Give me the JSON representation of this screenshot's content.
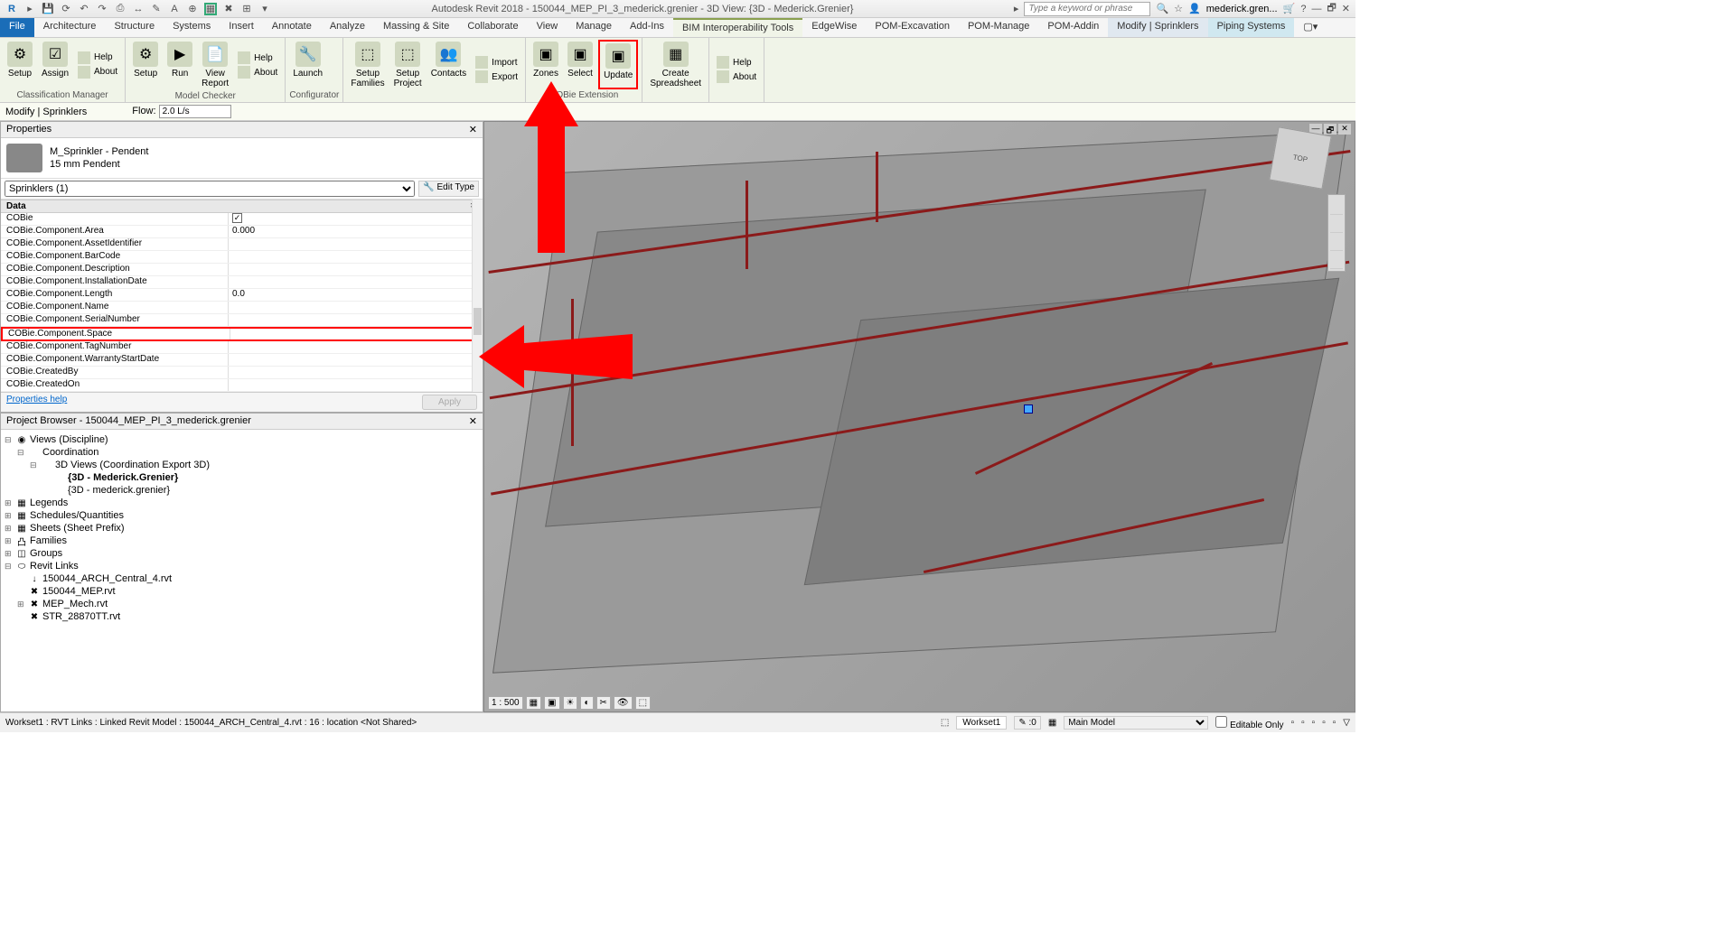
{
  "titlebar": {
    "app": "Autodesk Revit 2018",
    "doc": "150044_MEP_PI_3_mederick.grenier - 3D View: {3D - Mederick.Grenier}",
    "search_placeholder": "Type a keyword or phrase",
    "user": "mederick.gren..."
  },
  "tabs": {
    "file": "File",
    "list": [
      "Architecture",
      "Structure",
      "Systems",
      "Insert",
      "Annotate",
      "Analyze",
      "Massing & Site",
      "Collaborate",
      "View",
      "Manage",
      "Add-Ins",
      "BIM Interoperability Tools",
      "EdgeWise",
      "POM-Excavation",
      "POM-Manage",
      "POM-Addin"
    ],
    "context": [
      "Modify | Sprinklers",
      "Piping Systems"
    ],
    "active": "BIM Interoperability Tools"
  },
  "ribbon": {
    "groups": [
      {
        "label": "Classification Manager",
        "buttons": [
          {
            "l": "Setup"
          },
          {
            "l": "Assign"
          }
        ],
        "small": [
          {
            "l": "Help"
          },
          {
            "l": "About"
          }
        ]
      },
      {
        "label": "Model Checker",
        "buttons": [
          {
            "l": "Setup"
          },
          {
            "l": "Run"
          },
          {
            "l": "View\nReport"
          }
        ],
        "small": [
          {
            "l": "Help"
          },
          {
            "l": "About"
          }
        ]
      },
      {
        "label": "Configurator",
        "buttons": [
          {
            "l": "Launch"
          }
        ]
      },
      {
        "label": "",
        "buttons": [
          {
            "l": "Setup\nFamilies"
          },
          {
            "l": "Setup\nProject"
          },
          {
            "l": "Contacts"
          }
        ],
        "small": [
          {
            "l": "Import"
          },
          {
            "l": "Export"
          }
        ]
      },
      {
        "label": "COBie Extension",
        "buttons": [
          {
            "l": "Zones"
          },
          {
            "l": "Select"
          },
          {
            "l": "Update",
            "hl": true
          }
        ]
      },
      {
        "label": "",
        "buttons": [
          {
            "l": "Create\nSpreadsheet"
          }
        ]
      },
      {
        "label": "",
        "small": [
          {
            "l": "Help"
          },
          {
            "l": "About"
          }
        ]
      }
    ]
  },
  "modifybar": {
    "label": "Modify | Sprinklers",
    "flow_label": "Flow:",
    "flow_value": "2.0 L/s"
  },
  "props": {
    "title": "Properties",
    "type_name": "M_Sprinkler - Pendent",
    "type_size": "15 mm Pendent",
    "selector": "Sprinklers (1)",
    "edit_type": "Edit Type",
    "section": "Data",
    "rows": [
      {
        "n": "COBie",
        "v": "",
        "check": true
      },
      {
        "n": "COBie.Component.Area",
        "v": "0.000"
      },
      {
        "n": "COBie.Component.AssetIdentifier",
        "v": ""
      },
      {
        "n": "COBie.Component.BarCode",
        "v": ""
      },
      {
        "n": "COBie.Component.Description",
        "v": ""
      },
      {
        "n": "COBie.Component.InstallationDate",
        "v": ""
      },
      {
        "n": "COBie.Component.Length",
        "v": "0.0"
      },
      {
        "n": "COBie.Component.Name",
        "v": ""
      },
      {
        "n": "COBie.Component.SerialNumber",
        "v": ""
      },
      {
        "n": "COBie.Component.Space",
        "v": "",
        "hl": true
      },
      {
        "n": "COBie.Component.TagNumber",
        "v": ""
      },
      {
        "n": "COBie.Component.WarrantyStartDate",
        "v": ""
      },
      {
        "n": "COBie.CreatedBy",
        "v": ""
      },
      {
        "n": "COBie.CreatedOn",
        "v": ""
      }
    ],
    "help": "Properties help",
    "apply": "Apply"
  },
  "browser": {
    "title": "Project Browser - 150044_MEP_PI_3_mederick.grenier",
    "nodes": [
      {
        "txt": "Views (Discipline)",
        "ind": 0,
        "exp": "⊟",
        "icon": "◉"
      },
      {
        "txt": "Coordination",
        "ind": 1,
        "exp": "⊟"
      },
      {
        "txt": "3D Views (Coordination Export 3D)",
        "ind": 2,
        "exp": "⊟"
      },
      {
        "txt": "{3D - Mederick.Grenier}",
        "ind": 3,
        "bold": true
      },
      {
        "txt": "{3D - mederick.grenier}",
        "ind": 3
      },
      {
        "txt": "Legends",
        "ind": 0,
        "exp": "⊞",
        "icon": "▦"
      },
      {
        "txt": "Schedules/Quantities",
        "ind": 0,
        "exp": "⊞",
        "icon": "▦"
      },
      {
        "txt": "Sheets (Sheet Prefix)",
        "ind": 0,
        "exp": "⊞",
        "icon": "▦"
      },
      {
        "txt": "Families",
        "ind": 0,
        "exp": "⊞",
        "icon": "凸"
      },
      {
        "txt": "Groups",
        "ind": 0,
        "exp": "⊞",
        "icon": "◫"
      },
      {
        "txt": "Revit Links",
        "ind": 0,
        "exp": "⊟",
        "icon": "⬭"
      },
      {
        "txt": "150044_ARCH_Central_4.rvt",
        "ind": 1,
        "icon": "↓"
      },
      {
        "txt": "150044_MEP.rvt",
        "ind": 1,
        "icon": "✖"
      },
      {
        "txt": "MEP_Mech.rvt",
        "ind": 1,
        "exp": "⊞",
        "icon": "✖"
      },
      {
        "txt": "STR_28870TT.rvt",
        "ind": 1,
        "icon": "✖"
      }
    ]
  },
  "viewport": {
    "navcube": "TOP",
    "scale": "1 : 500"
  },
  "statusbar": {
    "left": "Workset1 : RVT Links : Linked Revit Model : 150044_ARCH_Central_4.rvt : 16 : location <Not Shared>",
    "workset": "Workset1",
    "count": ":0",
    "model": "Main Model",
    "editable": "Editable Only"
  }
}
